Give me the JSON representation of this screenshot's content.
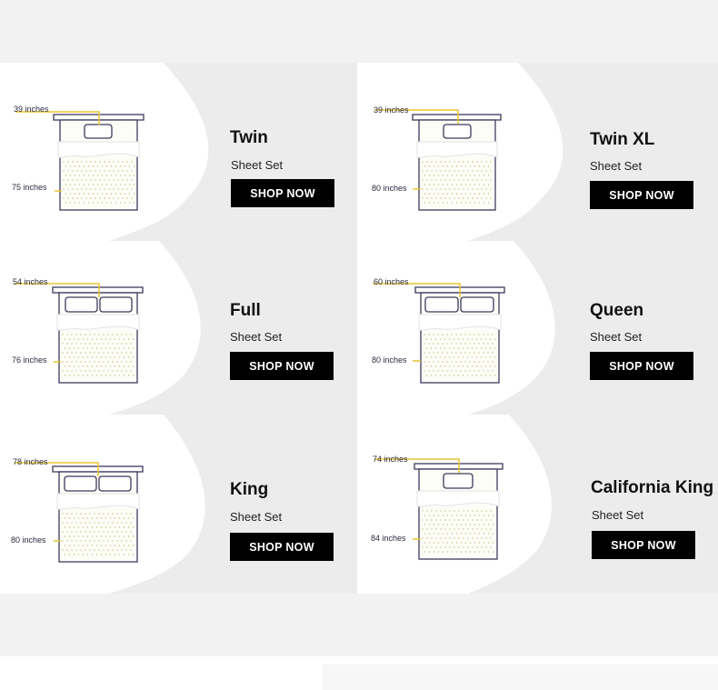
{
  "colors": {
    "page_band": "#f2f2f3",
    "card_bg": "#ececec",
    "blob": "#ffffff",
    "bed_outline": "#3d3a5c",
    "measure_line": "#e8c530",
    "button_bg": "#000000",
    "button_text": "#ffffff"
  },
  "cards": [
    {
      "title": "Twin",
      "subtitle": "Sheet Set",
      "button": "SHOP NOW",
      "width_label": "39 inches",
      "length_label": "75 inches",
      "pillows": 1
    },
    {
      "title": "Twin XL",
      "subtitle": "Sheet Set",
      "button": "SHOP NOW",
      "width_label": "39 inches",
      "length_label": "80 inches",
      "pillows": 1
    },
    {
      "title": "Full",
      "subtitle": "Sheet Set",
      "button": "SHOP NOW",
      "width_label": "54 inches",
      "length_label": "76 inches",
      "pillows": 2
    },
    {
      "title": "Queen",
      "subtitle": "Sheet Set",
      "button": "SHOP NOW",
      "width_label": "60 inches",
      "length_label": "80 inches",
      "pillows": 2
    },
    {
      "title": "King",
      "subtitle": "Sheet Set",
      "button": "SHOP NOW",
      "width_label": "78 inches",
      "length_label": "80 inches",
      "pillows": 2
    },
    {
      "title": "California King",
      "subtitle": "Sheet Set",
      "button": "SHOP NOW",
      "width_label": "74 inches",
      "length_label": "84 inches",
      "pillows": 1
    }
  ]
}
